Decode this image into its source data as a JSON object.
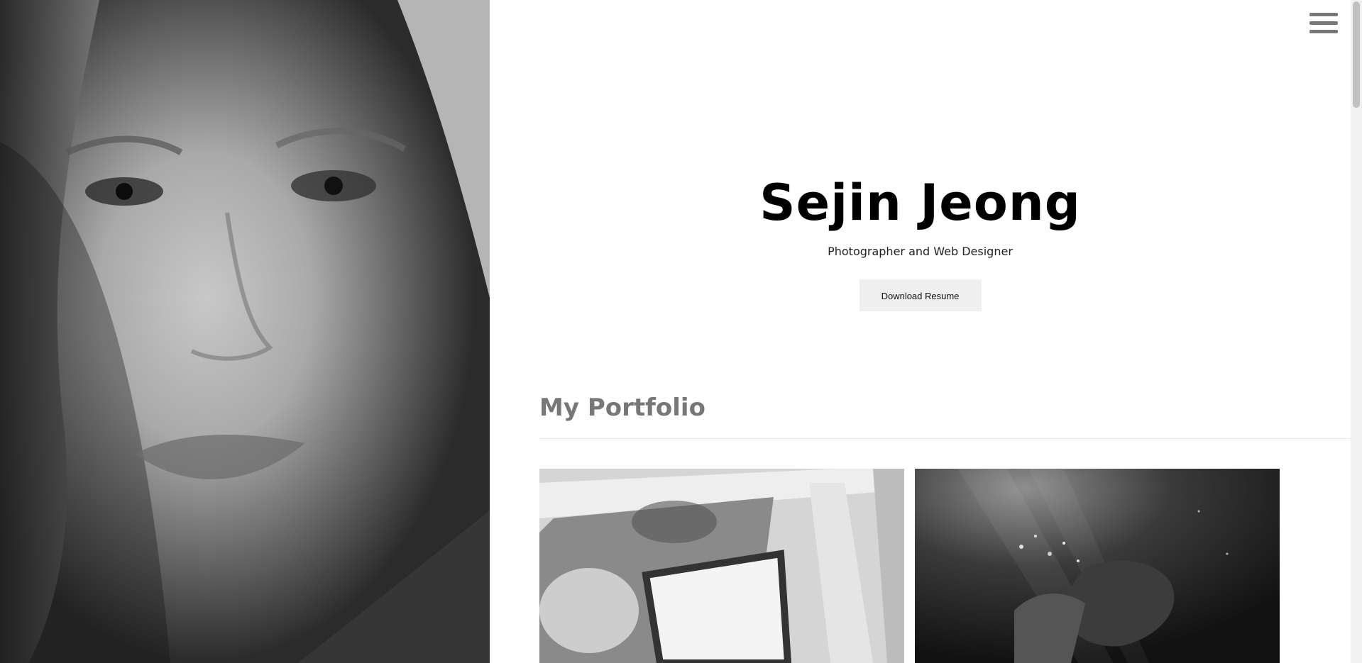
{
  "hero": {
    "name": "Sejin Jeong",
    "subtitle": "Photographer and Web Designer",
    "download_label": "Download Resume"
  },
  "portfolio": {
    "title": "My Portfolio",
    "items": [
      {
        "icon": "wedding-car-photo"
      },
      {
        "icon": "underwater-photo"
      }
    ]
  },
  "menu": {
    "icon": "hamburger-menu-icon"
  },
  "colors": {
    "accent_gray": "#777777",
    "button_bg": "#efefef"
  }
}
